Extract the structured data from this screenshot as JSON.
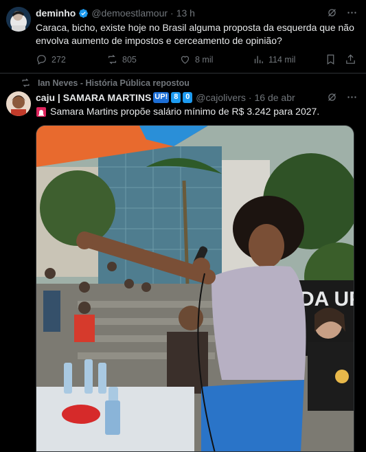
{
  "tweet1": {
    "display_name": "deminho",
    "handle": "@demoestlamour",
    "separator": "·",
    "time": "13 h",
    "text": "Caraca, bicho, existe hoje no Brasil alguma proposta da esquerda que não envolva aumento de impostos e cerceamento de opinião?",
    "replies": "272",
    "reposts": "805",
    "likes": "8 mil",
    "views": "114 mil"
  },
  "tweet2": {
    "repost_by": "Ian Neves - História Pública repostou",
    "display_name": "caju | SAMARA MARTINS",
    "badge_up": "UP!",
    "badge_8": "8",
    "badge_0": "0",
    "handle": "@cajolivers",
    "separator": "·",
    "time": "16 de abr",
    "text": "Samara Martins propõe salário mínimo de R$ 3.242 para 2027.",
    "media_banner_text": "DA UP"
  },
  "colors": {
    "background": "#000000",
    "text": "#e7e9ea",
    "muted": "#71767b",
    "verified": "#1d9bf0",
    "divider": "#2f3336"
  },
  "icons": [
    "verified-badge-icon",
    "grok-icon",
    "more-icon",
    "reply-icon",
    "repost-icon",
    "like-icon",
    "views-icon",
    "bookmark-icon",
    "share-icon",
    "siren-emoji-icon"
  ]
}
